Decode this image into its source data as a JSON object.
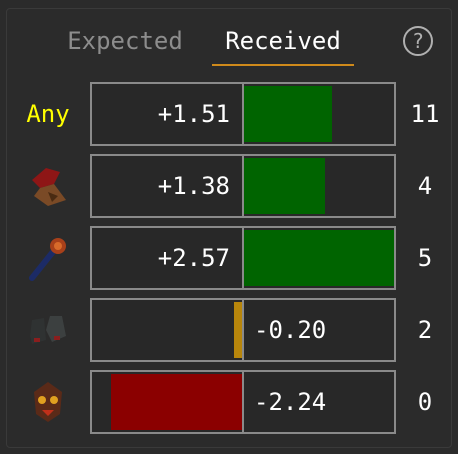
{
  "tabs": [
    {
      "label": "Expected",
      "active": false
    },
    {
      "label": "Received",
      "active": true
    }
  ],
  "help": {
    "label": "?"
  },
  "colors": {
    "positive": "#006400",
    "negative": "#8b0000",
    "neutral": "#b8860b",
    "label_yellow": "#ffff00"
  },
  "rows": [
    {
      "label": "Any",
      "icon": null,
      "value_text": "+1.51",
      "value": 1.51,
      "count": "11"
    },
    {
      "label": null,
      "icon": "red-hat-icon",
      "value_text": "+1.38",
      "value": 1.38,
      "count": "4"
    },
    {
      "label": null,
      "icon": "staff-icon",
      "value_text": "+2.57",
      "value": 2.57,
      "count": "5"
    },
    {
      "label": null,
      "icon": "boots-icon",
      "value_text": "-0.20",
      "value": -0.2,
      "count": "2"
    },
    {
      "label": null,
      "icon": "demon-mask-icon",
      "value_text": "-2.24",
      "value": -2.24,
      "count": "0"
    }
  ],
  "scale_max": 2.57
}
